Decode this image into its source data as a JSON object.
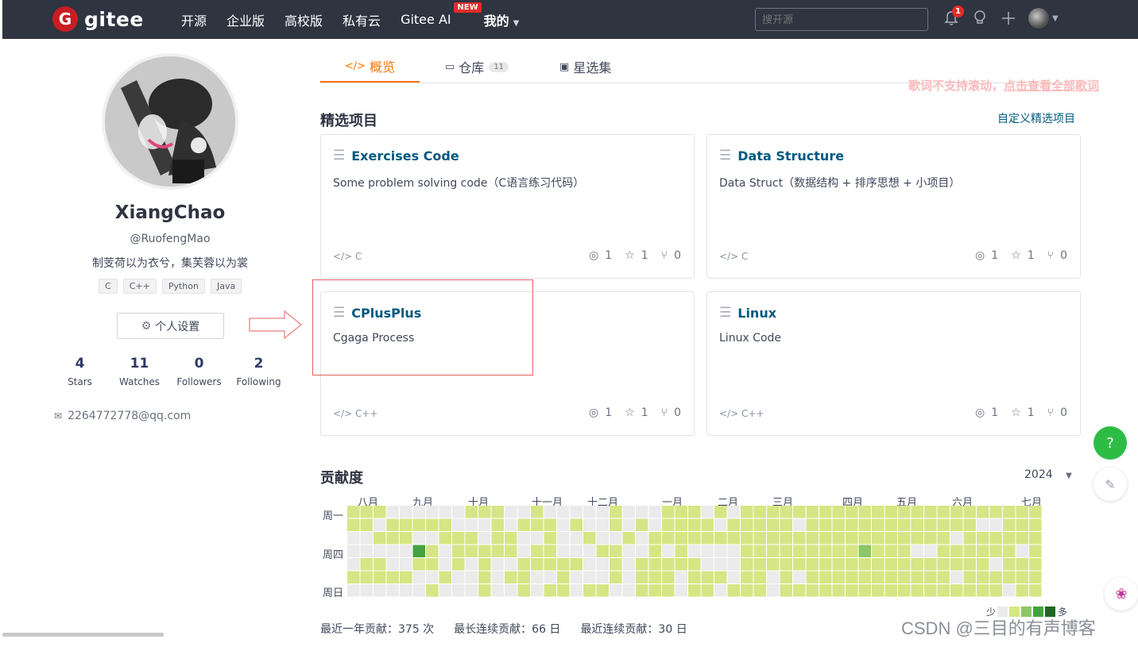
{
  "navbar": {
    "logo_mark": "G",
    "logo_text": "gitee",
    "items": [
      "开源",
      "企业版",
      "高校版",
      "私有云",
      "Gitee AI"
    ],
    "new_badge": "NEW",
    "mine": "我的",
    "search_placeholder": "搜开源",
    "notification_count": "1",
    "icons": [
      "bell-icon",
      "lightbulb-icon",
      "plus-icon",
      "avatar"
    ]
  },
  "profile": {
    "name": "XiangChao",
    "handle": "@RuofengMao",
    "bio": "制芰荷以为衣兮，集芙蓉以为裳",
    "tags": [
      "C",
      "C++",
      "Python",
      "Java"
    ],
    "settings_label": "个人设置",
    "stats": [
      {
        "value": "4",
        "label": "Stars"
      },
      {
        "value": "11",
        "label": "Watches"
      },
      {
        "value": "0",
        "label": "Followers"
      },
      {
        "value": "2",
        "label": "Following"
      }
    ],
    "email": "2264772778@qq.com"
  },
  "tabs": [
    {
      "label": "概览",
      "icon": "code-overview-icon",
      "active": true
    },
    {
      "label": "仓库",
      "icon": "repo-icon",
      "count": "11"
    },
    {
      "label": "星选集",
      "icon": "star-collection-icon"
    }
  ],
  "lyric_notice": {
    "text": "歌词不支持滚动，",
    "link": "点击查看全部歌词"
  },
  "featured": {
    "title": "精选项目",
    "custom_link": "自定义精选项目",
    "cards": [
      {
        "title": "Exercises Code",
        "desc": "Some problem solving code（C语言练习代码）",
        "lang": "C",
        "watch": "1",
        "star": "1",
        "fork": "0"
      },
      {
        "title": "Data Structure",
        "desc": "Data Struct（数据结构 + 排序思想 + 小项目）",
        "lang": "C",
        "watch": "1",
        "star": "1",
        "fork": "0"
      },
      {
        "title": "CPlusPlus",
        "desc": "Cgaga Process",
        "lang": "C++",
        "watch": "1",
        "star": "1",
        "fork": "0"
      },
      {
        "title": "Linux",
        "desc": "Linux Code",
        "lang": "C++",
        "watch": "1",
        "star": "1",
        "fork": "0"
      }
    ]
  },
  "contribution": {
    "title": "贡献度",
    "year": "2024",
    "months": [
      "八月",
      "九月",
      "十月",
      "十一月",
      "十二月",
      "一月",
      "二月",
      "三月",
      "四月",
      "五月",
      "六月",
      "七月"
    ],
    "days": [
      "周一",
      "周四",
      "周日"
    ],
    "summary": [
      "最近一年贡献：375 次",
      "最长连续贡献：66 日",
      "最近连续贡献：30 日"
    ],
    "legend_low": "少",
    "legend_high": "多",
    "colors": {
      "empty": "#ebebeb",
      "l1": "#d6e685",
      "l2": "#8cc665",
      "l3": "#44a340",
      "l4": "#1e6823"
    }
  },
  "watermark": "CSDN @三目的有声博客",
  "help_label": "?"
}
